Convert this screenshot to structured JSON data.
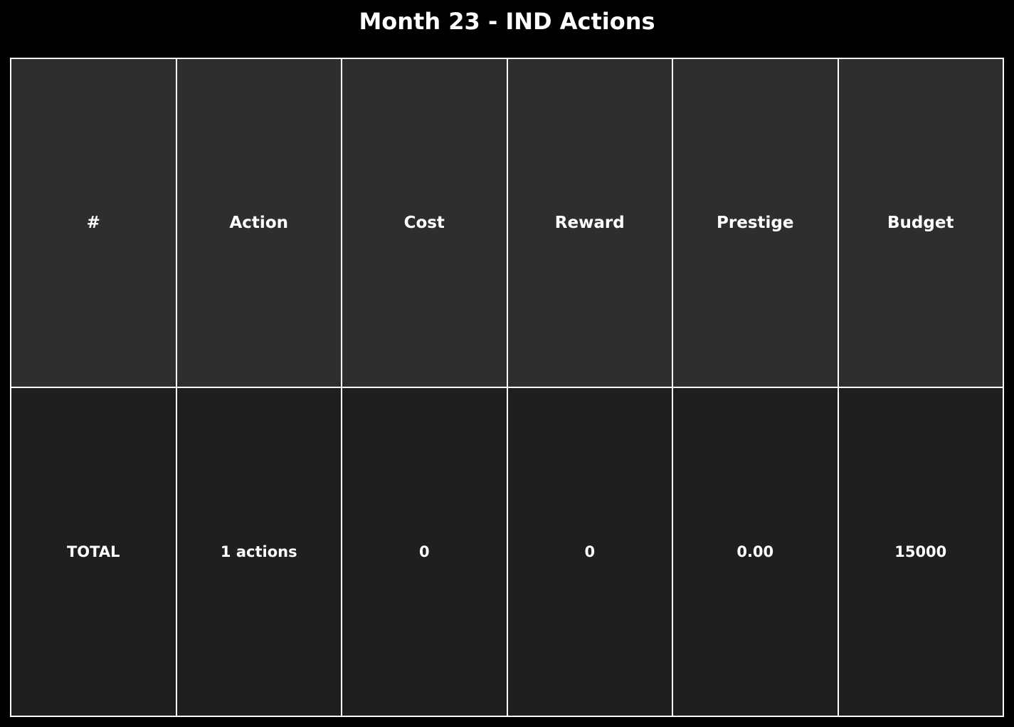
{
  "title": "Month 23 - IND Actions",
  "chart_data": {
    "type": "table",
    "title": "Month 23 - IND Actions",
    "columns": [
      "#",
      "Action",
      "Cost",
      "Reward",
      "Prestige",
      "Budget"
    ],
    "rows": [
      [
        "TOTAL",
        "1 actions",
        "0",
        "0",
        "0.00",
        "15000"
      ]
    ]
  },
  "colors": {
    "background": "#000000",
    "header_cell": "#2e2e2e",
    "body_cell": "#1f1f1f",
    "grid": "#ffffff",
    "text": "#ffffff"
  }
}
